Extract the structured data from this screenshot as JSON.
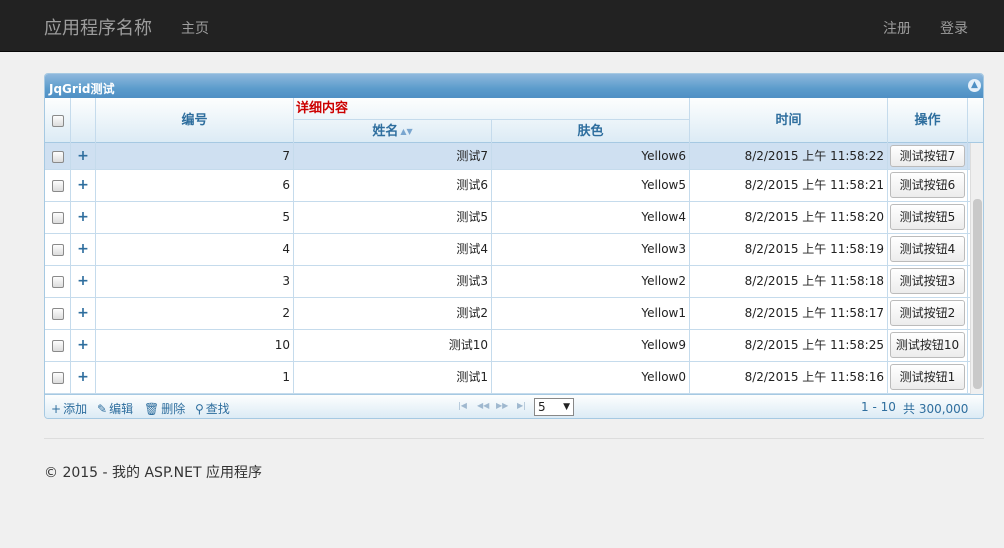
{
  "nav": {
    "brand": "应用程序名称",
    "home": "主页",
    "register": "注册",
    "login": "登录"
  },
  "grid": {
    "caption": "JqGrid测试",
    "headers": {
      "id": "编号",
      "group": "详细内容",
      "name": "姓名",
      "color": "肤色",
      "time": "时间",
      "action": "操作"
    },
    "rows": [
      {
        "id": "7",
        "name": "测试7",
        "color": "Yellow6",
        "time": "8/2/2015 上午 11:58:22",
        "button": "测试按钮7"
      },
      {
        "id": "6",
        "name": "测试6",
        "color": "Yellow5",
        "time": "8/2/2015 上午 11:58:21",
        "button": "测试按钮6"
      },
      {
        "id": "5",
        "name": "测试5",
        "color": "Yellow4",
        "time": "8/2/2015 上午 11:58:20",
        "button": "测试按钮5"
      },
      {
        "id": "4",
        "name": "测试4",
        "color": "Yellow3",
        "time": "8/2/2015 上午 11:58:19",
        "button": "测试按钮4"
      },
      {
        "id": "3",
        "name": "测试3",
        "color": "Yellow2",
        "time": "8/2/2015 上午 11:58:18",
        "button": "测试按钮3"
      },
      {
        "id": "2",
        "name": "测试2",
        "color": "Yellow1",
        "time": "8/2/2015 上午 11:58:17",
        "button": "测试按钮2"
      },
      {
        "id": "10",
        "name": "测试10",
        "color": "Yellow9",
        "time": "8/2/2015 上午 11:58:25",
        "button": "测试按钮10"
      },
      {
        "id": "1",
        "name": "测试1",
        "color": "Yellow0",
        "time": "8/2/2015 上午 11:58:16",
        "button": "测试按钮1"
      }
    ],
    "pager": {
      "add": "添加",
      "edit": "编辑",
      "delete": "删除",
      "search": "查找",
      "page_size": "5",
      "range": "1 - 10",
      "total": "共 300,000 条"
    }
  },
  "footer": "© 2015 - 我的 ASP.NET 应用程序",
  "colors": {
    "navbar": "#222222",
    "header_text": "#2e6e9e",
    "group_header": "#cc0000",
    "selected_row": "#cfe0f1"
  }
}
